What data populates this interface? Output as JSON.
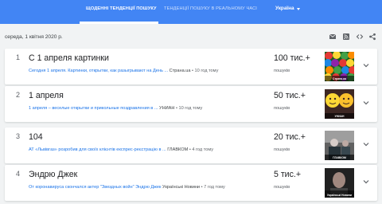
{
  "nav": {
    "tab_daily": "ЩОДЕННІ ТЕНДЕНЦІЇ ПОШУКУ",
    "tab_realtime": "ТЕНДЕНЦІЇ ПОШУКУ В РЕАЛЬНОМУ ЧАСІ",
    "country": "Україна"
  },
  "date_label": "середа, 1 квітня 2020 р.",
  "toolbar_icons": [
    "email-icon",
    "rss-icon",
    "embed-code-icon",
    "share-icon"
  ],
  "colors": {
    "header": "#4285f4",
    "link": "#1a73e8",
    "background": "#f1f3f4"
  },
  "trends": [
    {
      "rank": "1",
      "title": "С 1 апреля картинки",
      "snippet": "Сегодня 1 апреля. Картинки, открытки, как разыгрывают на День ...",
      "source": "Страна.ua",
      "time": "• 10 год тому",
      "count": "100 тис.+",
      "count_label": "пошуків",
      "thumb_caption": "Страна.ua"
    },
    {
      "rank": "2",
      "title": "1 апреля",
      "snippet": "1 апреля – веселые открытки и прикольные поздравления в ...",
      "source": "УНИАН",
      "time": "• 10 год тому",
      "count": "50 тис.+",
      "count_label": "пошуків",
      "thumb_caption": "УНИАН"
    },
    {
      "rank": "3",
      "title": "104",
      "snippet": "АТ «Львівгаз» розробив для своїх клієнтів експрес-реєстрацію в ...",
      "source": "ГЛАВКОМ",
      "time": "• 4 год тому",
      "count": "20 тис.+",
      "count_label": "пошуків",
      "thumb_caption": "ГЛАВКОМ"
    },
    {
      "rank": "4",
      "title": "Эндрю Джек",
      "snippet": "От коронавируса скончался актер \"Звездных войн\" Эндрю Джек",
      "source": "Українські Новини",
      "time": "• 7 год тому",
      "count": "5 тис.+",
      "count_label": "пошуків",
      "thumb_caption": "Українські Новини"
    }
  ]
}
